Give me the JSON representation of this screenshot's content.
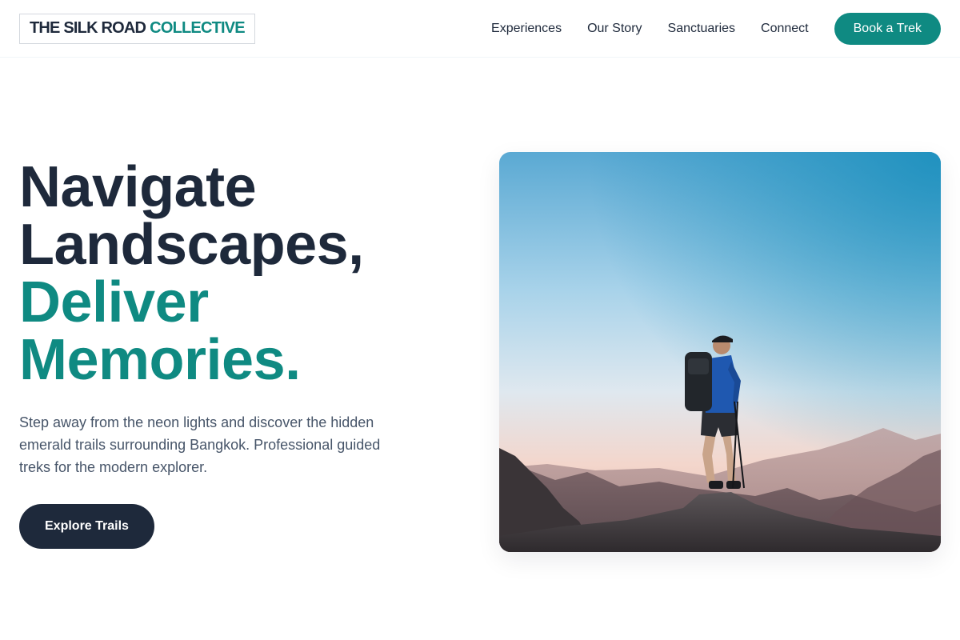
{
  "brand": {
    "name_part_1": "THE SILK ROAD",
    "name_part_2": "COLLECTIVE",
    "accent_color": "#0f8a82",
    "dark_color": "#1e293b"
  },
  "nav": {
    "items": [
      {
        "label": "Experiences"
      },
      {
        "label": "Our Story"
      },
      {
        "label": "Sanctuaries"
      },
      {
        "label": "Connect"
      }
    ],
    "cta_label": "Book a Trek"
  },
  "hero": {
    "headline_line_1": "Navigate",
    "headline_line_2": "Landscapes,",
    "headline_line_3": "Deliver",
    "headline_line_4": "Memories.",
    "description": "Step away from the neon lights and discover the hidden emerald trails surrounding Bangkok. Professional guided treks for the modern explorer.",
    "button_label": "Explore Trails",
    "image_subject": "hiker-on-mountain-summit-photo"
  }
}
